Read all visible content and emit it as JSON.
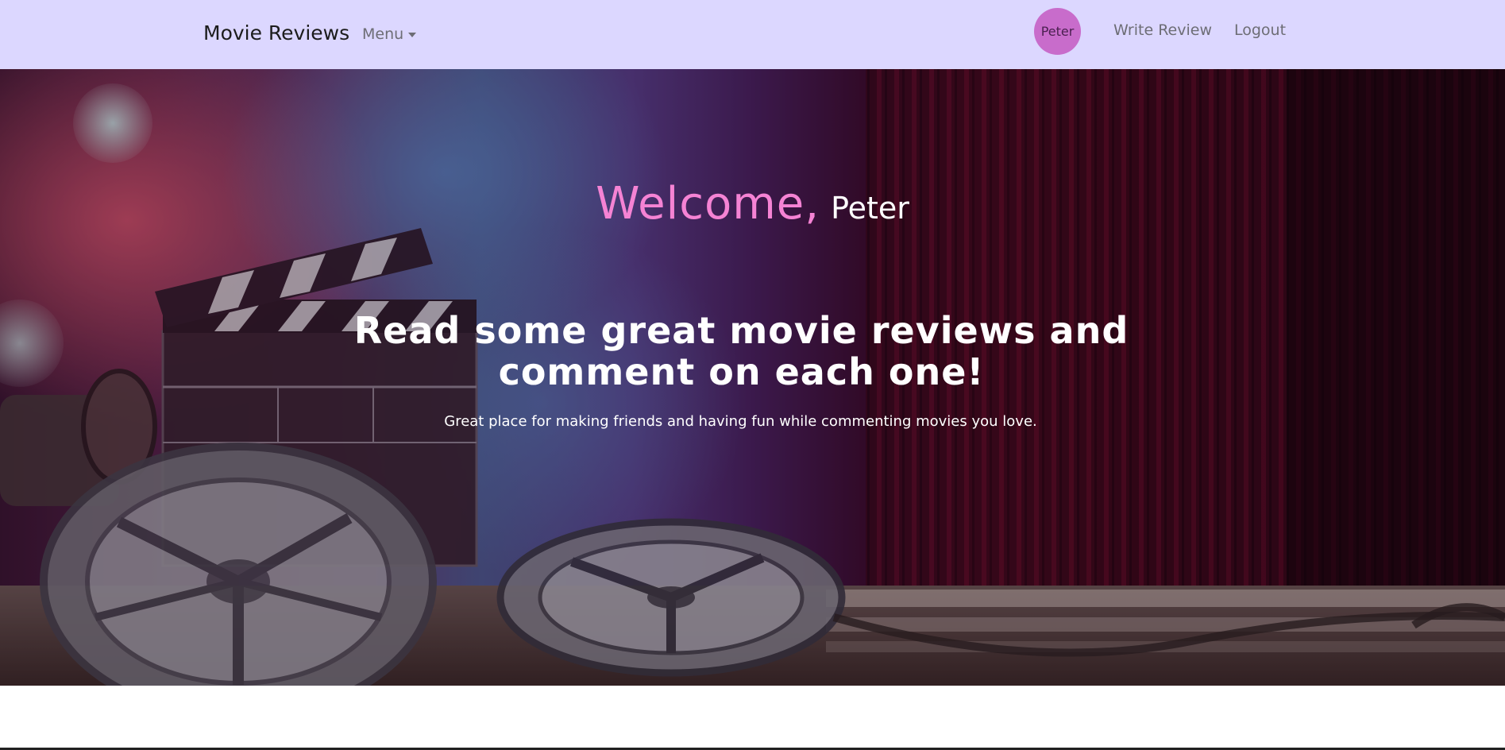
{
  "navbar": {
    "brand": "Movie Reviews",
    "menu_label": "Menu",
    "avatar_name": "Peter",
    "links": {
      "write_review": "Write Review",
      "logout": "Logout"
    },
    "background_color": "#dcd7ff",
    "avatar_color": "#c86ccb"
  },
  "hero": {
    "welcome_word": "Welcome,",
    "welcome_name": "Peter",
    "headline": "Read some great movie reviews and comment on each one!",
    "subline": "Great place for making friends and having fun while commenting movies you love.",
    "accent_color": "#f583d4",
    "image_subject": "cinema clapperboard, film reels and red stage curtain"
  }
}
